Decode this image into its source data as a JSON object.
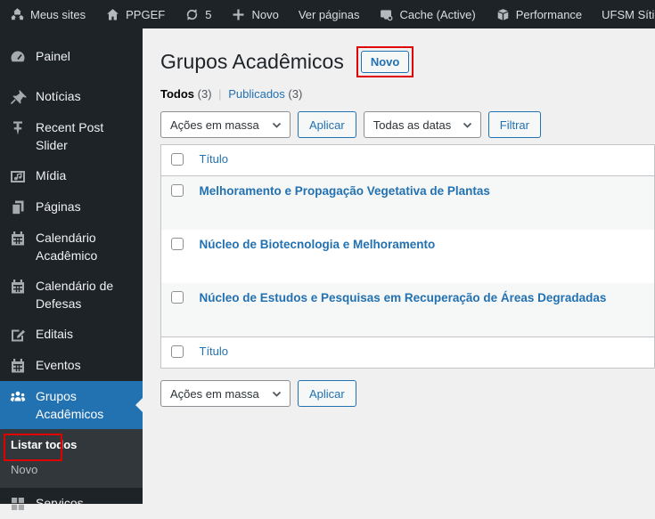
{
  "colors": {
    "accent_blue": "#2271b1",
    "annotation_red": "#e10000",
    "admin_bar_bg": "#1d2327",
    "sidebar_bg": "#1d2327",
    "submenu_bg": "#32373c",
    "content_bg": "#f0f0f1",
    "row_stripe": "#f6f7f7",
    "link_blue": "#2271b1"
  },
  "icons": {
    "multisite-icon": "cluster of houses",
    "home-icon": "house",
    "update-icon": "circular refresh arrows",
    "plus-icon": "plus sign",
    "cache-icon": "drive with badge",
    "performance-icon": "3d package box",
    "dashboard-icon": "gauge",
    "pin-icon": "push pin",
    "thumbtack-icon": "sticky tack",
    "media-icon": "frame with music note",
    "pages-icon": "stacked pages",
    "calendar-icon": "calendar grid",
    "edit-icon": "pencil on page",
    "groups-icon": "three people",
    "grid-icon": "four squares",
    "chevron-down-icon": "v chevron"
  },
  "admin_bar": {
    "items": [
      {
        "label": "Meus sites",
        "icon": "multisite-icon"
      },
      {
        "label": "PPGEF",
        "icon": "home-icon"
      },
      {
        "label": "5",
        "icon": "update-icon"
      },
      {
        "label": "Novo",
        "icon": "plus-icon"
      },
      {
        "label": "Ver páginas",
        "icon": null
      },
      {
        "label": "Cache (Active)",
        "icon": "cache-icon"
      },
      {
        "label": "Performance",
        "icon": "performance-icon"
      },
      {
        "label": "UFSM Sítios",
        "icon": null
      }
    ]
  },
  "sidebar": {
    "items": [
      {
        "label": "Painel",
        "icon": "dashboard-icon"
      },
      {
        "label": "Notícias",
        "icon": "pin-icon"
      },
      {
        "label": "Recent Post Slider",
        "icon": "thumbtack-icon"
      },
      {
        "label": "Mídia",
        "icon": "media-icon"
      },
      {
        "label": "Páginas",
        "icon": "pages-icon"
      },
      {
        "label": "Calendário Acadêmico",
        "icon": "calendar-icon"
      },
      {
        "label": "Calendário de Defesas",
        "icon": "calendar-icon"
      },
      {
        "label": "Editais",
        "icon": "edit-icon"
      },
      {
        "label": "Eventos",
        "icon": "calendar-icon"
      },
      {
        "label": "Grupos Acadêmicos",
        "icon": "groups-icon",
        "active": true
      },
      {
        "label": "Serviços",
        "icon": "grid-icon"
      }
    ],
    "submenu": {
      "items": [
        {
          "label": "Listar todos",
          "current": true
        },
        {
          "label": "Novo",
          "current": false
        }
      ]
    }
  },
  "main": {
    "page_title": "Grupos Acadêmicos",
    "new_button_label": "Novo",
    "views": {
      "all_label": "Todos",
      "all_count": "(3)",
      "separator": "|",
      "published_label": "Publicados",
      "published_count": "(3)"
    },
    "toolbar": {
      "bulk_actions_label": "Ações em massa",
      "apply_label": "Aplicar",
      "dates_label": "Todas as datas",
      "filter_label": "Filtrar"
    },
    "table": {
      "title_column": "Título",
      "rows": [
        {
          "title": "Melhoramento e Propagação Vegetativa de Plantas"
        },
        {
          "title": "Núcleo de Biotecnologia e Melhoramento"
        },
        {
          "title": "Núcleo de Estudos e Pesquisas em Recuperação de Áreas Degradadas"
        }
      ]
    }
  }
}
